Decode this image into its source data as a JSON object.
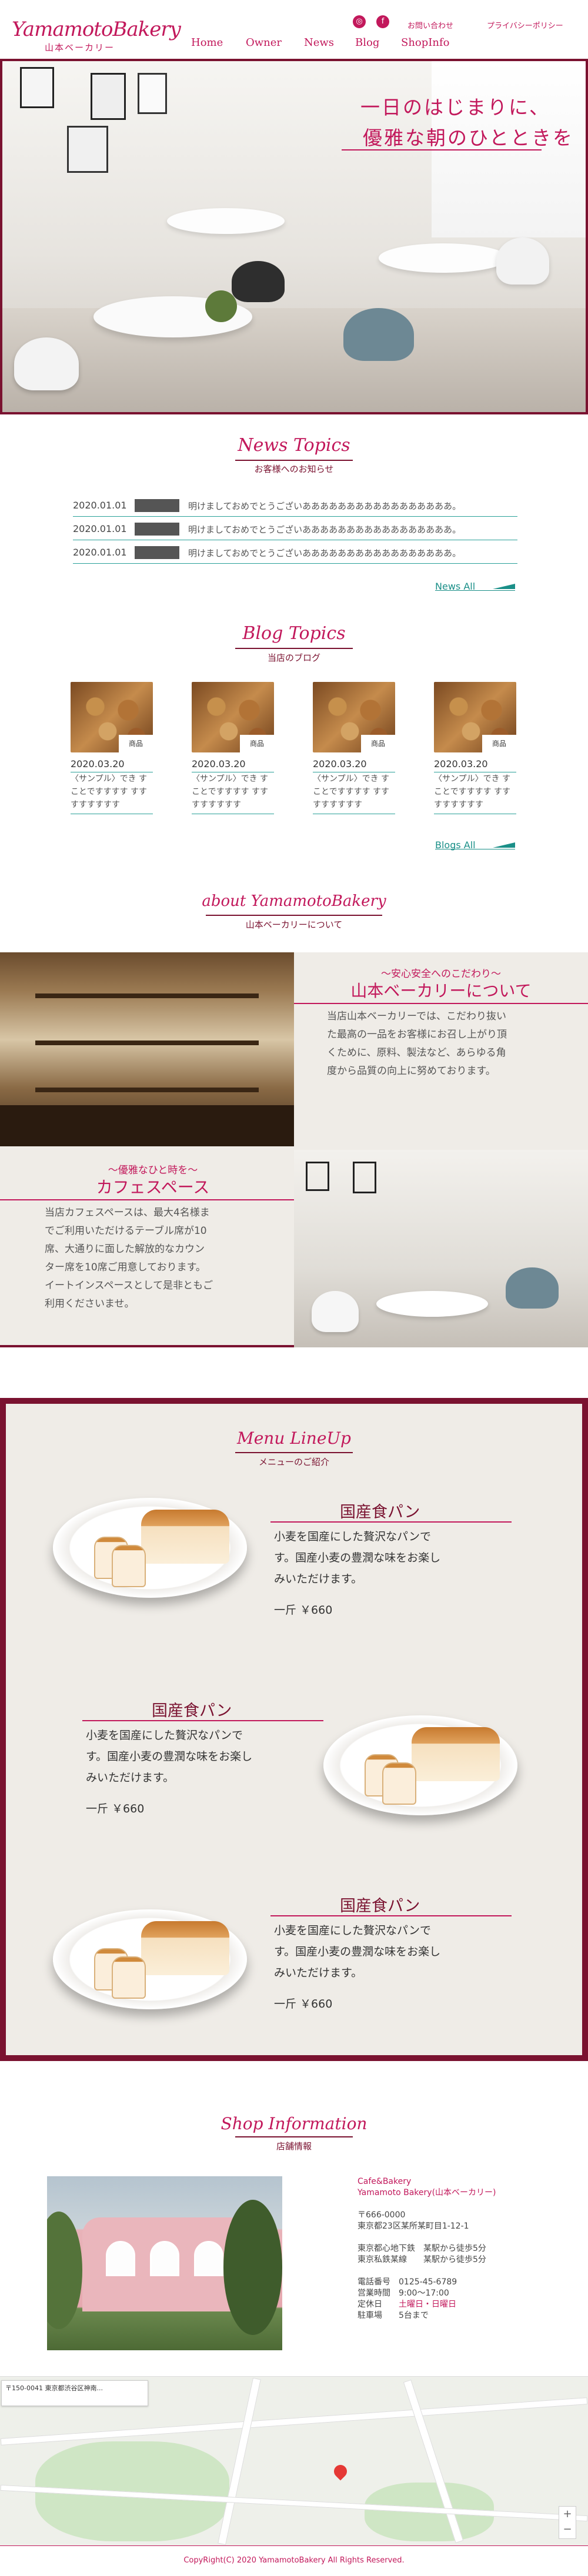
{
  "header": {
    "logo": "YamamotoBakery",
    "logo_sub": "山本ベーカリー",
    "nav": [
      "Home",
      "Owner",
      "News",
      "Blog",
      "ShopInfo"
    ],
    "contact": "お問い合わせ",
    "privacy": "プライバシーポリシー",
    "sns": [
      "instagram-icon",
      "facebook-icon"
    ]
  },
  "hero": {
    "line1": "一日のはじまりに、",
    "line2": "優雅な朝のひとときを"
  },
  "news": {
    "title": "News Topics",
    "subtitle": "お客様へのお知らせ",
    "items": [
      {
        "date": "2020.01.01",
        "text": "明けましておめでとうございあああああああああああああああああ。"
      },
      {
        "date": "2020.01.01",
        "text": "明けましておめでとうございあああああああああああああああああ。"
      },
      {
        "date": "2020.01.01",
        "text": "明けましておめでとうございあああああああああああああああああ。"
      }
    ],
    "more": "News All"
  },
  "blog": {
    "title": "Blog Topics",
    "subtitle": "当店のブログ",
    "items": [
      {
        "badge": "商品",
        "date": "2020.03.20",
        "text": "〈サンプル〉でき すことですすすす すすすすすすすす"
      },
      {
        "badge": "商品",
        "date": "2020.03.20",
        "text": "〈サンプル〉でき すことですすすす すすすすすすすす"
      },
      {
        "badge": "商品",
        "date": "2020.03.20",
        "text": "〈サンプル〉でき すことですすすす すすすすすすすす"
      },
      {
        "badge": "商品",
        "date": "2020.03.20",
        "text": "〈サンプル〉でき すことですすすす すすすすすすすす"
      }
    ],
    "more": "Blogs All"
  },
  "about": {
    "title": "about YamamotoBakery",
    "subtitle": "山本ベーカリーについて",
    "block1": {
      "kicker": "〜安心安全へのこだわり〜",
      "heading": "山本ベーカリーについて",
      "body": [
        "当店山本ベーカリーでは、こだわり抜い",
        "た最高の一品をお客様にお召し上がり頂",
        "くために、原料、製法など、あらゆる角",
        "度から品質の向上に努めております。"
      ]
    },
    "block2": {
      "kicker": "〜優雅なひと時を〜",
      "heading": "カフェスペース",
      "body": [
        "当店カフェスペースは、最大4名様ま",
        "でご利用いただけるテーブル席が10",
        "席、大通りに面した解放的なカウン",
        "ター席を10席ご用意しております。",
        "イートインスペースとして是非ともご",
        "利用くださいませ。"
      ]
    }
  },
  "menu": {
    "title": "Menu LineUp",
    "subtitle": "メニューのご紹介",
    "items": [
      {
        "name": "国産食パン",
        "desc": [
          "小麦を国産にした贅沢なパンで",
          "す。国産小麦の豊潤な味をお楽し",
          "みいただけます。"
        ],
        "price": "一斤 ￥660"
      },
      {
        "name": "国産食パン",
        "desc": [
          "小麦を国産にした贅沢なパンで",
          "す。国産小麦の豊潤な味をお楽し",
          "みいただけます。"
        ],
        "price": "一斤 ￥660"
      },
      {
        "name": "国産食パン",
        "desc": [
          "小麦を国産にした贅沢なパンで",
          "す。国産小麦の豊潤な味をお楽し",
          "みいただけます。"
        ],
        "price": "一斤 ￥660"
      }
    ]
  },
  "shop": {
    "title": "Shop Information",
    "subtitle": "店舗情報",
    "name1": "Cafe&Bakery",
    "name2": "Yamamoto Bakery(山本ベーカリー)",
    "zip": "〒666-0000",
    "address": "東京都23区某所某町目1-12-1",
    "access1": "東京都心地下鉄　某駅から徒歩5分",
    "access2": "東京私鉄某線　　某駅から徒歩5分",
    "tel_label": "電話番号",
    "tel": "0125-45-6789",
    "hours_label": "営業時間",
    "hours": "9:00〜17:00",
    "closed_label": "定休日",
    "closed": "土曜日・日曜日",
    "parking_label": "駐車場",
    "parking": "5台まで"
  },
  "map": {
    "card": "〒150-0041 東京都渋谷区神南..."
  },
  "footer": {
    "copy": "CopyRight(C) 2020 YamamotoBakery All Rights Reserved."
  }
}
